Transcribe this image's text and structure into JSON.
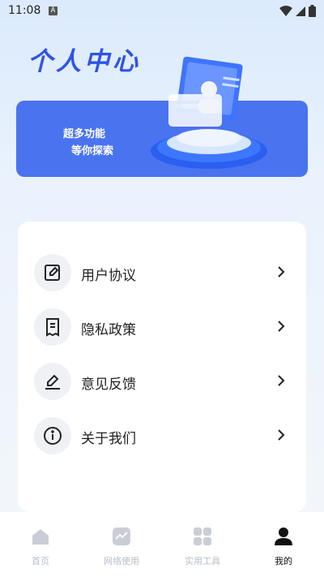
{
  "status_bar": {
    "time": "11:08",
    "notification_icon": "A"
  },
  "page_title": "个人中心",
  "banner": {
    "line1": "超多功能",
    "line2": "等你探索"
  },
  "menu": [
    {
      "label": "用户协议",
      "icon": "edit-doc-icon"
    },
    {
      "label": "隐私政策",
      "icon": "receipt-icon"
    },
    {
      "label": "意见反馈",
      "icon": "pen-icon"
    },
    {
      "label": "关于我们",
      "icon": "info-icon"
    }
  ],
  "tabs": [
    {
      "label": "首页",
      "icon": "home-icon"
    },
    {
      "label": "网络使用",
      "icon": "chart-icon"
    },
    {
      "label": "实用工具",
      "icon": "grid-icon"
    },
    {
      "label": "我的",
      "icon": "person-icon",
      "active": true
    }
  ],
  "colors": {
    "accent": "#4a73f0",
    "title": "#2f53e6",
    "tab_inactive": "#b8bec8"
  }
}
